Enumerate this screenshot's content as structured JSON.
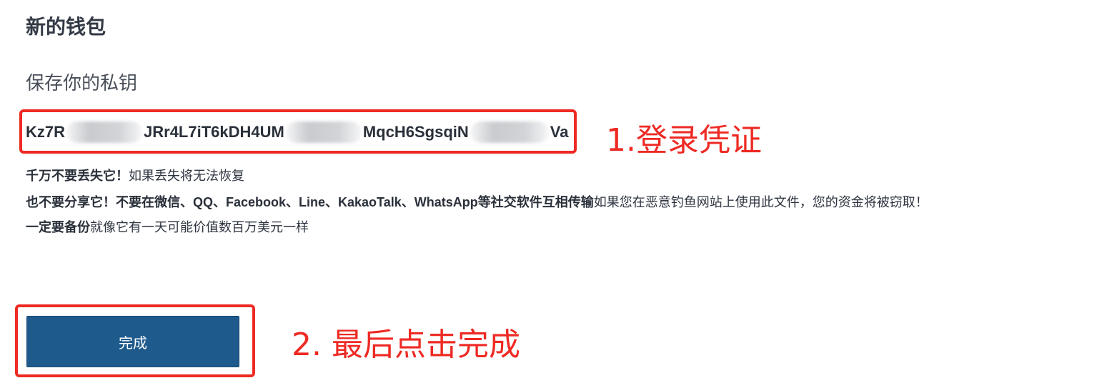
{
  "page": {
    "title": "新的钱包",
    "subtitle": "保存你的私钥"
  },
  "private_key": {
    "segments": [
      "Kz7R",
      "JRr4L7iT6kDH4UM",
      "MqcH6SgsqiN",
      "Va"
    ]
  },
  "warnings": {
    "line1_bold": "千万不要丢失它！",
    "line1_text": "如果丢失将无法恢复",
    "line2_bold": "也不要分享它！不要在微信、QQ、Facebook、Line、KakaoTalk、WhatsApp等社交软件互相传输",
    "line2_text": "如果您在恶意钓鱼网站上使用此文件，您的资金将被窃取！",
    "line3_bold": "一定要备份",
    "line3_text": "就像它有一天可能价值数百万美元一样"
  },
  "actions": {
    "done_label": "完成"
  },
  "annotations": {
    "step1": "1.登录凭证",
    "step2": "2. 最后点击完成"
  },
  "colors": {
    "highlight": "#ee2a24",
    "button_bg": "#1f5a8c"
  }
}
